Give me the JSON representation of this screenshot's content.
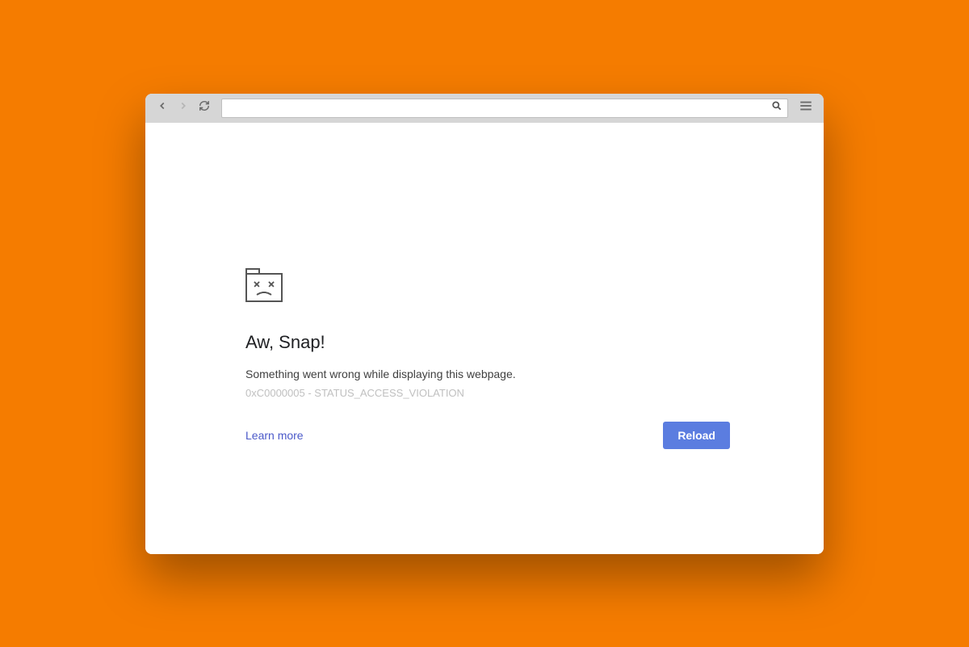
{
  "address_bar": {
    "value": ""
  },
  "error": {
    "title": "Aw, Snap!",
    "message": "Something went wrong while displaying this webpage.",
    "code": "0xC0000005 - STATUS_ACCESS_VIOLATION",
    "learn_more": "Learn more",
    "reload": "Reload"
  },
  "colors": {
    "page_bg": "#f57c00",
    "button_bg": "#5b7de0",
    "link": "#4b59c9"
  }
}
